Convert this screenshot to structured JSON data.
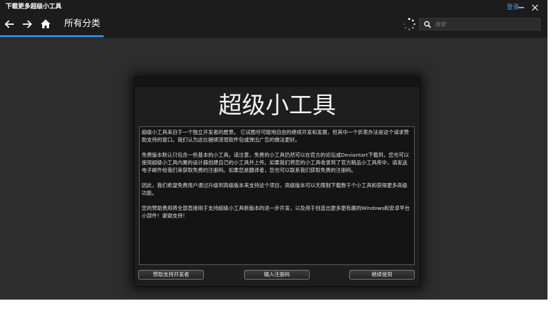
{
  "window": {
    "title": "下载更多超级小工具",
    "login_label": "登录"
  },
  "toolbar": {
    "category_title": "所有分类",
    "search_placeholder": "搜索"
  },
  "dialog": {
    "title": "超级小工具",
    "paragraphs": [
      "超级小工具来自于一个独立开发者的愿景。 它试图尽可能地自由的继续开发和发展，但其中一个折衷办法是这个请求赞助支持的窗口。我们认为这比捆绑流氓软件包或弹出广告的做法更好。",
      "免费版本默认只包含一些基本的小工具。请注意，免费的小工具仍然可以在官方的论坛或Deviantart下载到，您也可以使用超级小工具内置的设计器创建自己的小工具并上传。如果我们将您的小工具收录到了官方精品小工具库中，请发送电子邮件给我们来获取免费的注册码。如果您是翻译者，您也可以联系我们获取免费的注册码。",
      "因此，我们希望免费用户通过升级到高级版本来支持这个项目，高级版本可以无限制下载数千个小工具和获得更多高级功能。",
      "您的赞助费用将全部直接用于支持超级小工具新版本的进一步开发，以及用于创造出更多更有趣的Windows和安卓平台小部件！谢谢支持！"
    ],
    "buttons": {
      "sponsor": "赞助支持开发者",
      "enter_code": "输入注册码",
      "continue": "继续使用"
    }
  },
  "colors": {
    "accent": "#2d8ae0",
    "link": "#4a9ce6",
    "background": "#2d2d2d",
    "bar": "#1c1c1c"
  },
  "icons": [
    "back-arrow-icon",
    "forward-arrow-icon",
    "home-icon",
    "loading-spinner-icon",
    "search-icon",
    "minimize-icon",
    "close-icon"
  ]
}
